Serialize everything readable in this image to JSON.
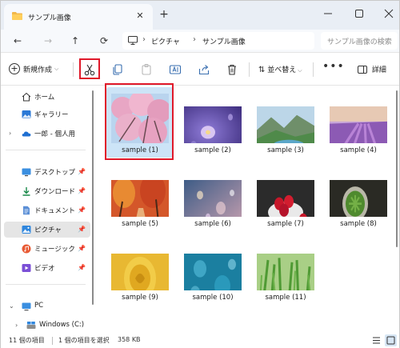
{
  "window": {
    "tab_title": "サンプル画像",
    "new_tab": "+"
  },
  "address": {
    "crumbs": [
      "ピクチャ",
      "サンプル画像"
    ],
    "search_placeholder": "サンプル画像の検索"
  },
  "toolbar": {
    "new_label": "新規作成",
    "sort_label": "並べ替え",
    "more_label": "•••",
    "details_label": "詳細",
    "icons": [
      "cut-icon",
      "copy-icon",
      "paste-icon",
      "rename-icon",
      "share-icon",
      "delete-icon"
    ]
  },
  "sidebar": {
    "items": [
      {
        "label": "ホーム",
        "icon": "home-icon"
      },
      {
        "label": "ギャラリー",
        "icon": "gallery-icon"
      },
      {
        "label": "一郎 - 個人用",
        "icon": "onedrive-icon"
      },
      {
        "label": "デスクトップ",
        "icon": "desktop-icon",
        "pinned": true
      },
      {
        "label": "ダウンロード",
        "icon": "download-icon",
        "pinned": true
      },
      {
        "label": "ドキュメント",
        "icon": "documents-icon",
        "pinned": true
      },
      {
        "label": "ピクチャ",
        "icon": "pictures-icon",
        "pinned": true,
        "selected": true
      },
      {
        "label": "ミュージック",
        "icon": "music-icon",
        "pinned": true
      },
      {
        "label": "ビデオ",
        "icon": "video-icon",
        "pinned": true
      },
      {
        "label": "PC",
        "icon": "pc-icon"
      },
      {
        "label": "Windows (C:)",
        "icon": "drive-icon"
      }
    ]
  },
  "files": [
    {
      "name": "sample (1)",
      "selected": true
    },
    {
      "name": "sample (2)"
    },
    {
      "name": "sample (3)"
    },
    {
      "name": "sample (4)"
    },
    {
      "name": "sample (5)"
    },
    {
      "name": "sample (6)"
    },
    {
      "name": "sample (7)"
    },
    {
      "name": "sample (8)"
    },
    {
      "name": "sample (9)"
    },
    {
      "name": "sample (10)"
    },
    {
      "name": "sample (11)"
    }
  ],
  "status": {
    "count": "11 個の項目",
    "selected": "1 個の項目を選択",
    "size": "358 KB"
  },
  "colors": {
    "highlight": "#e0192a",
    "selection": "#cce4f7",
    "titlebar": "#e9eef5"
  }
}
